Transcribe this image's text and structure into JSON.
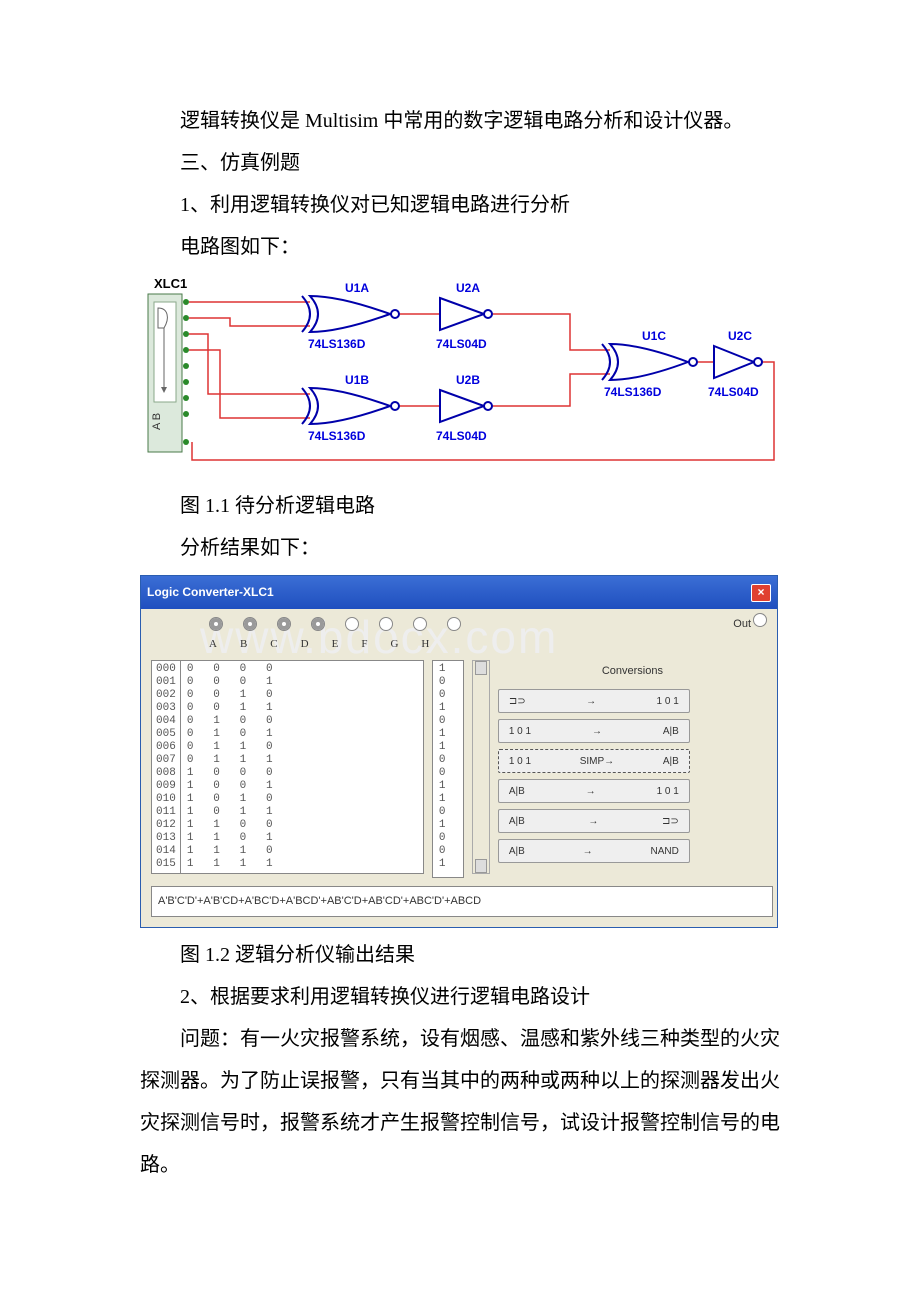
{
  "paragraphs": {
    "p1": "逻辑转换仪是 Multisim 中常用的数字逻辑电路分析和设计仪器。",
    "p2": "三、仿真例题",
    "p3": "1、利用逻辑转换仪对已知逻辑电路进行分析",
    "p4": "电路图如下：",
    "cap1": "图 1.1 待分析逻辑电路",
    "p5": "分析结果如下：",
    "cap2": "图 1.2 逻辑分析仪输出结果",
    "p6": "2、根据要求利用逻辑转换仪进行逻辑电路设计",
    "p7": "问题：有一火灾报警系统，设有烟感、温感和紫外线三种类型的火灾探测器。为了防止误报警，只有当其中的两种或两种以上的探测器发出火灾探测信号时，报警系统才产生报警控制信号，试设计报警控制信号的电路。"
  },
  "watermark": "www.bdocx.com",
  "circuit": {
    "instrument": "XLC1",
    "instrument_label": "A  B",
    "gates": {
      "u1a": "U1A",
      "u1a_part": "74LS136D",
      "u1b": "U1B",
      "u1b_part": "74LS136D",
      "u1c": "U1C",
      "u1c_part": "74LS136D",
      "u2a": "U2A",
      "u2a_part": "74LS04D",
      "u2b": "U2B",
      "u2b_part": "74LS04D",
      "u2c": "U2C",
      "u2c_part": "74LS04D"
    }
  },
  "logic_converter": {
    "title": "Logic Converter-XLC1",
    "out_label": "Out",
    "letters": [
      "A",
      "B",
      "C",
      "D",
      "E",
      "F",
      "G",
      "H"
    ],
    "conversions_label": "Conversions",
    "buttons": [
      {
        "left": "⊐⊃",
        "mid": "→",
        "right": "1 0 1"
      },
      {
        "left": "1 0 1",
        "mid": "→",
        "right": "A|B"
      },
      {
        "left": "1 0 1",
        "mid": "SIMP→",
        "right": "A|B"
      },
      {
        "left": "A|B",
        "mid": "→",
        "right": "1 0 1"
      },
      {
        "left": "A|B",
        "mid": "→",
        "right": "⊐⊃"
      },
      {
        "left": "A|B",
        "mid": "→",
        "right": "NAND"
      }
    ],
    "truth_table": {
      "rows": [
        {
          "idx": "000",
          "bits": "0   0   0   0",
          "out": "1"
        },
        {
          "idx": "001",
          "bits": "0   0   0   1",
          "out": "0"
        },
        {
          "idx": "002",
          "bits": "0   0   1   0",
          "out": "0"
        },
        {
          "idx": "003",
          "bits": "0   0   1   1",
          "out": "1"
        },
        {
          "idx": "004",
          "bits": "0   1   0   0",
          "out": "0"
        },
        {
          "idx": "005",
          "bits": "0   1   0   1",
          "out": "1"
        },
        {
          "idx": "006",
          "bits": "0   1   1   0",
          "out": "1"
        },
        {
          "idx": "007",
          "bits": "0   1   1   1",
          "out": "0"
        },
        {
          "idx": "008",
          "bits": "1   0   0   0",
          "out": "0"
        },
        {
          "idx": "009",
          "bits": "1   0   0   1",
          "out": "1"
        },
        {
          "idx": "010",
          "bits": "1   0   1   0",
          "out": "1"
        },
        {
          "idx": "011",
          "bits": "1   0   1   1",
          "out": "0"
        },
        {
          "idx": "012",
          "bits": "1   1   0   0",
          "out": "1"
        },
        {
          "idx": "013",
          "bits": "1   1   0   1",
          "out": "0"
        },
        {
          "idx": "014",
          "bits": "1   1   1   0",
          "out": "0"
        },
        {
          "idx": "015",
          "bits": "1   1   1   1",
          "out": "1"
        }
      ]
    },
    "expression": "A'B'C'D'+A'B'CD+A'BC'D+A'BCD'+AB'C'D+AB'CD'+ABC'D'+ABCD"
  }
}
